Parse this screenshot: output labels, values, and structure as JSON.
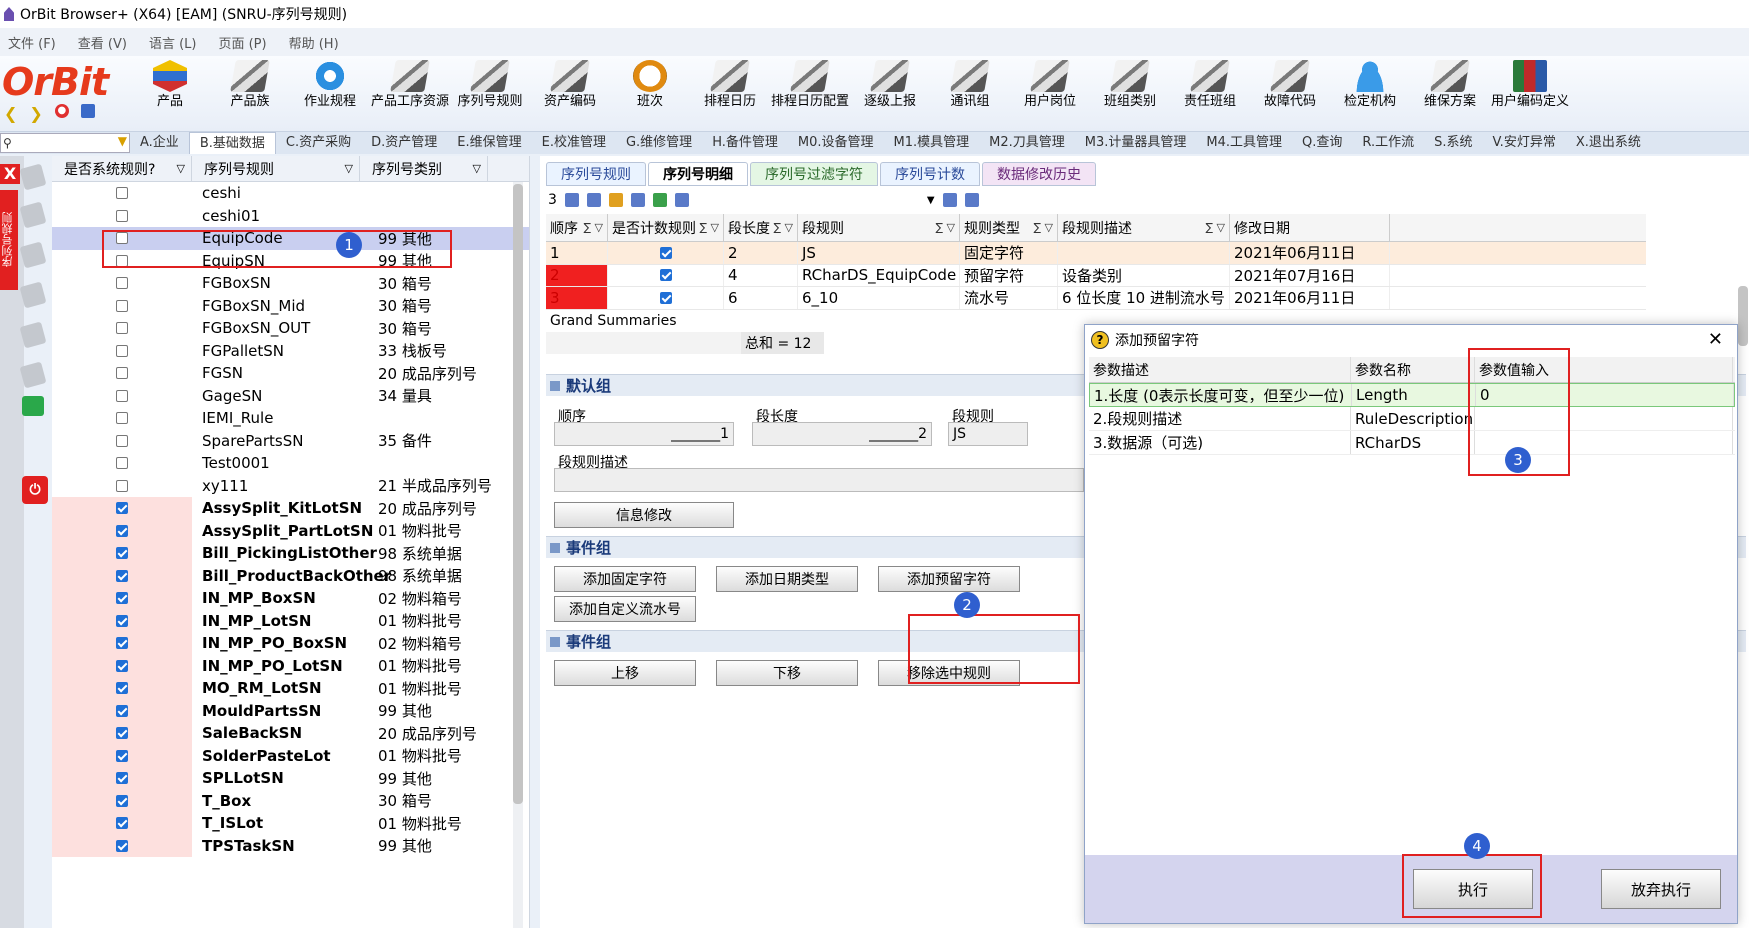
{
  "window": {
    "title": "OrBit Browser+ (X64) [EAM] (SNRU-序列号规则)"
  },
  "menu": [
    "文件 (F)",
    "查看 (V)",
    "语言 (L)",
    "页面 (P)",
    "帮助 (H)"
  ],
  "logo": "OrBit",
  "toolbar": [
    {
      "label": "产品",
      "icon": "cube"
    },
    {
      "label": "产品族",
      "icon": "stack"
    },
    {
      "label": "作业规程",
      "icon": "gear"
    },
    {
      "label": "产品工序资源",
      "icon": "stack"
    },
    {
      "label": "序列号规则",
      "icon": "stack"
    },
    {
      "label": "资产编码",
      "icon": "stack"
    },
    {
      "label": "班次",
      "icon": "clock"
    },
    {
      "label": "排程日历",
      "icon": "stack"
    },
    {
      "label": "排程日历配置",
      "icon": "stack"
    },
    {
      "label": "逐级上报",
      "icon": "stack"
    },
    {
      "label": "通讯组",
      "icon": "stack"
    },
    {
      "label": "用户岗位",
      "icon": "stack"
    },
    {
      "label": "班组类别",
      "icon": "stack"
    },
    {
      "label": "责任班组",
      "icon": "stack"
    },
    {
      "label": "故障代码",
      "icon": "stack"
    },
    {
      "label": "检定机构",
      "icon": "person"
    },
    {
      "label": "维保方案",
      "icon": "stack"
    },
    {
      "label": "用户编码定义",
      "icon": "books"
    }
  ],
  "nav_tabs": [
    "A.企业",
    "B.基础数据",
    "C.资产采购",
    "D.资产管理",
    "E.维保管理",
    "E.校准管理",
    "G.维修管理",
    "H.备件管理",
    "M0.设备管理",
    "M1.模具管理",
    "M2.刀具管理",
    "M3.计量器具管理",
    "M4.工具管理",
    "Q.查询",
    "R.工作流",
    "S.系统",
    "V.安灯异常",
    "X.退出系统"
  ],
  "nav_active_index": 1,
  "strip": {
    "label": "序列号规则",
    "close": "X"
  },
  "left_panel": {
    "headers": [
      "是否系统规则?",
      "序列号规则",
      "序列号类别"
    ],
    "rows": [
      {
        "sys": false,
        "name": "ceshi",
        "cat": ""
      },
      {
        "sys": false,
        "name": "ceshi01",
        "cat": ""
      },
      {
        "sys": false,
        "name": "EquipCode",
        "cat": "99 其他",
        "selected": true
      },
      {
        "sys": false,
        "name": "EquipSN",
        "cat": "99 其他"
      },
      {
        "sys": false,
        "name": "FGBoxSN",
        "cat": "30 箱号"
      },
      {
        "sys": false,
        "name": "FGBoxSN_Mid",
        "cat": "30 箱号"
      },
      {
        "sys": false,
        "name": "FGBoxSN_OUT",
        "cat": "30 箱号"
      },
      {
        "sys": false,
        "name": "FGPalletSN",
        "cat": "33 栈板号"
      },
      {
        "sys": false,
        "name": "FGSN",
        "cat": "20 成品序列号"
      },
      {
        "sys": false,
        "name": "GageSN",
        "cat": "34 量具"
      },
      {
        "sys": false,
        "name": "IEMI_Rule",
        "cat": ""
      },
      {
        "sys": false,
        "name": "SparePartsSN",
        "cat": "35 备件"
      },
      {
        "sys": false,
        "name": "Test0001",
        "cat": ""
      },
      {
        "sys": false,
        "name": "xy111",
        "cat": "21 半成品序列号"
      },
      {
        "sys": true,
        "name": "AssySplit_KitLotSN",
        "cat": "20 成品序列号"
      },
      {
        "sys": true,
        "name": "AssySplit_PartLotSN",
        "cat": "01 物料批号"
      },
      {
        "sys": true,
        "name": "Bill_PickingListOther",
        "cat": "98 系统单据"
      },
      {
        "sys": true,
        "name": "Bill_ProductBackOther",
        "cat": "98 系统单据"
      },
      {
        "sys": true,
        "name": "IN_MP_BoxSN",
        "cat": "02 物料箱号"
      },
      {
        "sys": true,
        "name": "IN_MP_LotSN",
        "cat": "01 物料批号"
      },
      {
        "sys": true,
        "name": "IN_MP_PO_BoxSN",
        "cat": "02 物料箱号"
      },
      {
        "sys": true,
        "name": "IN_MP_PO_LotSN",
        "cat": "01 物料批号"
      },
      {
        "sys": true,
        "name": "MO_RM_LotSN",
        "cat": "01 物料批号"
      },
      {
        "sys": true,
        "name": "MouldPartsSN",
        "cat": "99 其他"
      },
      {
        "sys": true,
        "name": "SaleBackSN",
        "cat": "20 成品序列号"
      },
      {
        "sys": true,
        "name": "SolderPasteLot",
        "cat": "01 物料批号"
      },
      {
        "sys": true,
        "name": "SPLLotSN",
        "cat": "99 其他"
      },
      {
        "sys": true,
        "name": "T_Box",
        "cat": "30 箱号"
      },
      {
        "sys": true,
        "name": "T_ISLot",
        "cat": "01 物料批号"
      },
      {
        "sys": true,
        "name": "TPSTaskSN",
        "cat": "99 其他"
      }
    ]
  },
  "sub_tabs": [
    {
      "label": "序列号规则",
      "style": "blue"
    },
    {
      "label": "序列号明细",
      "style": "active"
    },
    {
      "label": "序列号过滤字符",
      "style": "green"
    },
    {
      "label": "序列号计数",
      "style": "blue"
    },
    {
      "label": "数据修改历史",
      "style": "pink"
    }
  ],
  "mini_toolbar": {
    "count": "3"
  },
  "grid": {
    "headers": [
      "顺序",
      "是否计数规则",
      "段长度",
      "段规则",
      "规则类型",
      "段规则描述",
      "修改日期"
    ],
    "rows": [
      {
        "seq": "1",
        "count": true,
        "len": "2",
        "rule": "JS",
        "type": "固定字符",
        "desc": "",
        "date": "2021年06月11日"
      },
      {
        "seq": "2",
        "count": true,
        "len": "4",
        "rule": "RCharDS_EquipCode",
        "type": "预留字符",
        "desc": "设备类别",
        "date": "2021年07月16日"
      },
      {
        "seq": "3",
        "count": true,
        "len": "6",
        "rule": "6_10",
        "type": "流水号",
        "desc": "6 位长度 10 进制流水号",
        "date": "2021年06月11日"
      }
    ],
    "summary_label": "Grand Summaries",
    "total": "总和 = 12"
  },
  "default_group": {
    "title": "默认组",
    "seq_label": "顺序",
    "seq_value": "_______1",
    "len_label": "段长度",
    "len_value": "_______2",
    "rule_label": "段规则",
    "rule_value": "JS",
    "desc_label": "段规则描述",
    "modify_btn": "信息修改"
  },
  "event_group1": {
    "title": "事件组",
    "buttons": [
      "添加固定字符",
      "添加日期类型",
      "添加预留字符",
      "添加自定义流水号"
    ]
  },
  "event_group2": {
    "title": "事件组",
    "buttons": [
      "上移",
      "下移",
      "移除选中规则"
    ]
  },
  "dialog": {
    "title": "添加预留字符",
    "headers": [
      "参数描述",
      "参数名称",
      "参数值输入"
    ],
    "rows": [
      {
        "desc": "1.长度 (0表示长度可变，但至少一位)",
        "name": "Length",
        "value": "0"
      },
      {
        "desc": "2.段规则描述",
        "name": "RuleDescription",
        "value": ""
      },
      {
        "desc": "3.数据源（可选)",
        "name": "RCharDS",
        "value": ""
      }
    ],
    "exec_btn": "执行",
    "cancel_btn": "放弃执行"
  },
  "annotations": [
    "1",
    "2",
    "3",
    "4"
  ],
  "colors": {
    "accent_red": "#e02020",
    "badge_blue": "#2f5fcf",
    "logo_red": "#e63a1c"
  }
}
